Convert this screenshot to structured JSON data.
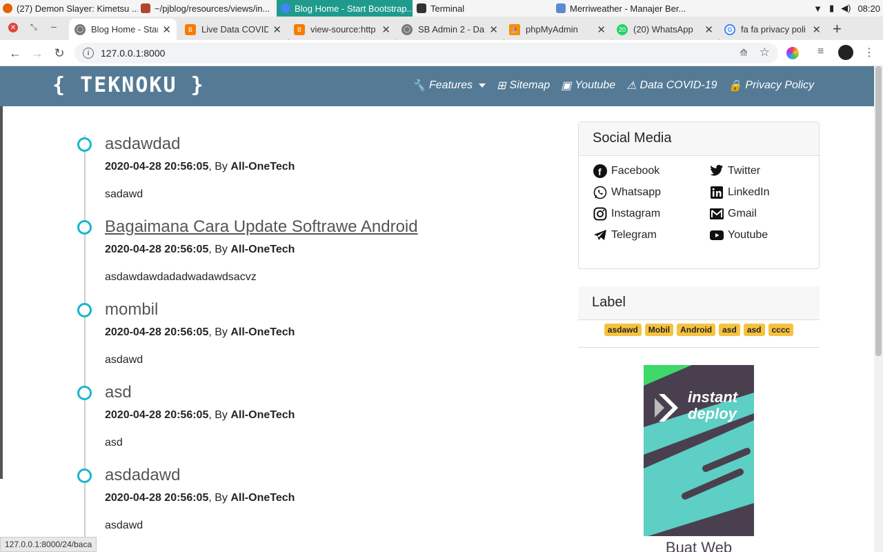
{
  "taskbar": {
    "tasks": [
      {
        "label": "(27) Demon Slayer: Kimetsu ..."
      },
      {
        "label": "~/pjblog/resources/views/in..."
      },
      {
        "label": "Blog Home - Start Bootstrap..."
      },
      {
        "label": "Terminal"
      },
      {
        "label": "Merriweather - Manajer Ber..."
      }
    ],
    "clock": "08:20"
  },
  "browser": {
    "tabs": [
      {
        "label": "Blog Home - Star"
      },
      {
        "label": "Live Data COVID"
      },
      {
        "label": "view-source:http"
      },
      {
        "label": "SB Admin 2 - Da"
      },
      {
        "label": "phpMyAdmin"
      },
      {
        "label": "(20) WhatsApp",
        "badge": "20"
      },
      {
        "label": "fa fa privacy poli"
      }
    ],
    "url": "127.0.0.1:8000",
    "status_url": "127.0.0.1:8000/24/baca"
  },
  "navbar": {
    "brand": "{ TEKNOKU }",
    "menu": [
      {
        "label": "Features",
        "icon": "wrench-icon"
      },
      {
        "label": "Sitemap",
        "icon": "sitemap-icon"
      },
      {
        "label": "Youtube",
        "icon": "youtube-icon"
      },
      {
        "label": "Data COVID-19",
        "icon": "warning-icon"
      },
      {
        "label": "Privacy Policy",
        "icon": "lock-icon"
      }
    ]
  },
  "posts": [
    {
      "title": "asdawdad",
      "date": "2020-04-28 20:56:05",
      "by": ", By ",
      "author": "All-OneTech",
      "body": "sadawd"
    },
    {
      "title": "Bagaimana Cara Update Softrawe Android",
      "date": "2020-04-28 20:56:05",
      "by": ", By ",
      "author": "All-OneTech",
      "body": "asdawdawdadadwadawdsacvz"
    },
    {
      "title": "mombil",
      "date": "2020-04-28 20:56:05",
      "by": ", By ",
      "author": "All-OneTech",
      "body": "asdawd"
    },
    {
      "title": "asd",
      "date": "2020-04-28 20:56:05",
      "by": ", By ",
      "author": "All-OneTech",
      "body": "asd"
    },
    {
      "title": "asdadawd",
      "date": "2020-04-28 20:56:05",
      "by": ", By ",
      "author": "All-OneTech",
      "body": "asdawd"
    }
  ],
  "social": {
    "title": "Social Media",
    "items": [
      {
        "label": "Facebook",
        "icon": "facebook-icon"
      },
      {
        "label": "Twitter",
        "icon": "twitter-icon"
      },
      {
        "label": "Whatsapp",
        "icon": "whatsapp-icon"
      },
      {
        "label": "LinkedIn",
        "icon": "linkedin-icon"
      },
      {
        "label": "Instagram",
        "icon": "instagram-icon"
      },
      {
        "label": "Gmail",
        "icon": "gmail-icon"
      },
      {
        "label": "Telegram",
        "icon": "telegram-icon"
      },
      {
        "label": "Youtube",
        "icon": "youtube-icon"
      }
    ]
  },
  "labels": {
    "title": "Label",
    "tags": [
      "asdawd",
      "Mobil",
      "Android",
      "asd",
      "asd",
      "cccc"
    ]
  },
  "ad": {
    "headline_1": "instant",
    "headline_2": "deploy",
    "cta": "Buat Web"
  },
  "colors": {
    "navbar": "#547a95",
    "timeline_dot": "#17b7ca",
    "badge": "#f6c23e",
    "active_task": "#1e9b8c"
  }
}
